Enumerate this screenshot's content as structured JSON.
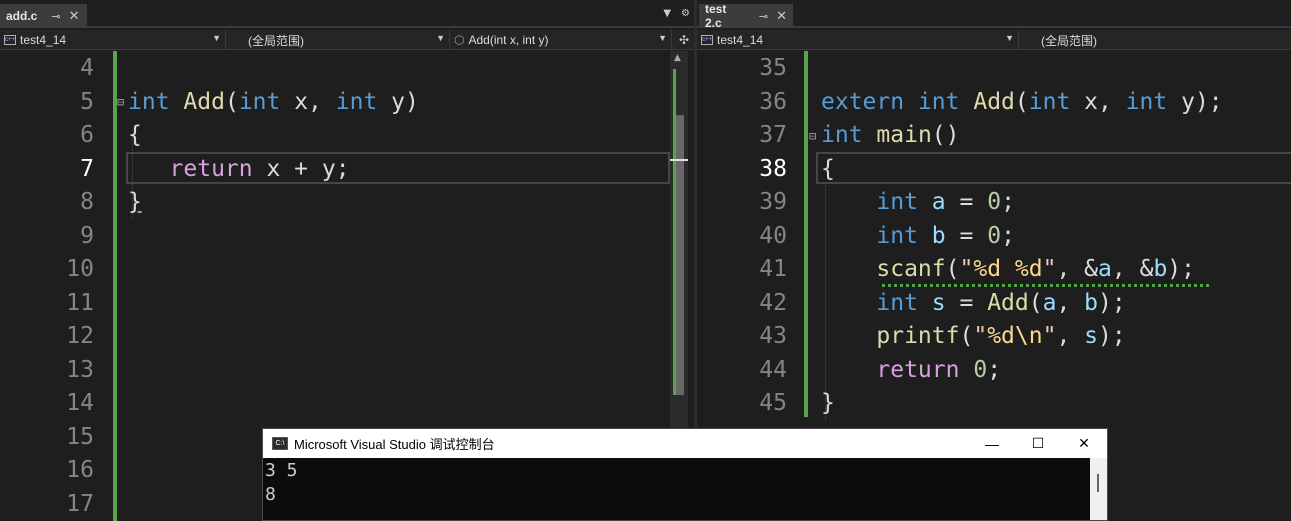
{
  "left_pane": {
    "tab": {
      "title": "add.c",
      "pin_icon": "pin-icon",
      "close_icon": "close-icon"
    },
    "tab_tools": {
      "dropdown_icon": "dropdown-icon",
      "gear_icon": "gear-icon"
    },
    "navbar": {
      "project": "test4_14",
      "scope": "(全局范围)",
      "member": "Add(int x, int y)"
    },
    "line_numbers": [
      "4",
      "5",
      "6",
      "7",
      "8",
      "9",
      "10",
      "11",
      "12",
      "13",
      "14",
      "15",
      "16",
      "17"
    ],
    "current_line": "7",
    "code": {
      "line5": {
        "kw1": "int",
        "fn": "Add",
        "p1": "(",
        "kw2": "int",
        "a1": " x, ",
        "kw3": "int",
        "a2": " y)"
      },
      "line6": "{",
      "line7": {
        "ret": "return",
        "rest": " x + y;"
      },
      "line8": "}"
    }
  },
  "right_pane": {
    "tab": {
      "title": "test 2.c",
      "pin_icon": "pin-icon",
      "close_icon": "close-icon"
    },
    "navbar": {
      "project": "test4_14",
      "scope": "(全局范围)"
    },
    "line_numbers": [
      "35",
      "36",
      "37",
      "38",
      "39",
      "40",
      "41",
      "42",
      "43",
      "44",
      "45"
    ],
    "current_line": "38",
    "code": {
      "line36": {
        "kw1": "extern",
        "kw2": "int",
        "fn": "Add",
        "p1": "(",
        "kw3": "int",
        "a1": " x, ",
        "kw4": "int",
        "a2": " y);"
      },
      "line37": {
        "kw1": "int",
        "fn": "main",
        "rest": "()"
      },
      "line38": "{",
      "line39": {
        "kw": "int",
        "var": "a",
        "op": " = ",
        "num": "0",
        "end": ";"
      },
      "line40": {
        "kw": "int",
        "var": "b",
        "op": " = ",
        "num": "0",
        "end": ";"
      },
      "line41": {
        "fn": "scanf",
        "p1": "(",
        "str1": "\"",
        "fmt1": "%d",
        "str2": " ",
        "fmt2": "%d",
        "str3": "\"",
        "mid": ", &",
        "v1": "a",
        "sep": ", &",
        "v2": "b",
        "end": ");"
      },
      "line42": {
        "kw": "int",
        "var": "s",
        "op": " = ",
        "fn": "Add",
        "p1": "(",
        "v1": "a",
        "sep": ", ",
        "v2": "b",
        "end": ");"
      },
      "line43": {
        "fn": "printf",
        "p1": "(",
        "str1": "\"",
        "fmt": "%d",
        "esc": "\\n",
        "str2": "\"",
        "sep": ", ",
        "v": "s",
        "end": ");"
      },
      "line44": {
        "ret": "return",
        "sp": " ",
        "num": "0",
        "end": ";"
      },
      "line45": "}"
    }
  },
  "console": {
    "title": "Microsoft Visual Studio 调试控制台",
    "icon": "console-app-icon",
    "minimize": "—",
    "maximize": "☐",
    "close": "✕",
    "output_line1": "3 5",
    "output_line2": "8"
  },
  "colors": {
    "keyword": "#569cd6",
    "control": "#d8a0df",
    "function": "#dcdcaa",
    "number": "#b5cea8",
    "variable": "#9cdcfe",
    "change_bar": "#57a64a"
  }
}
